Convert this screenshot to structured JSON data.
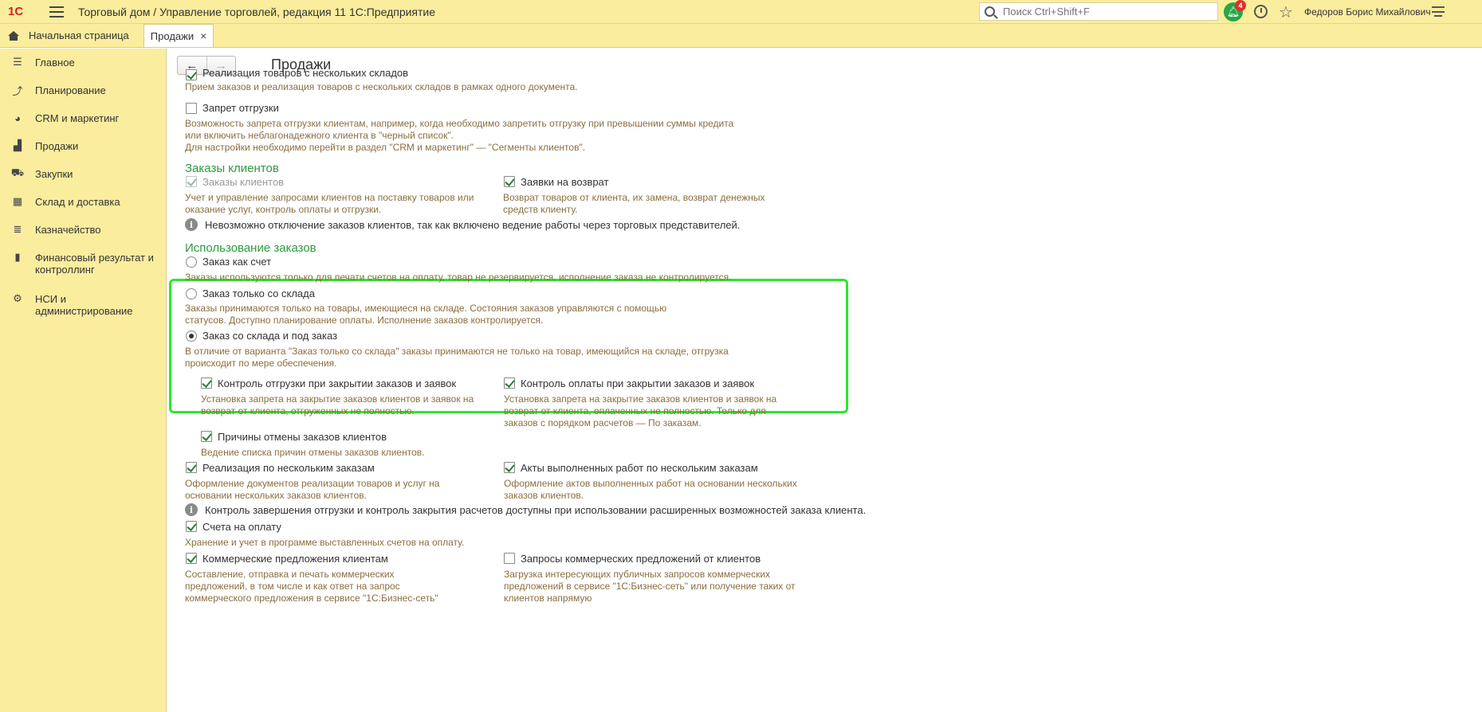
{
  "titlebar": {
    "logo": "1С",
    "title": "Торговый дом / Управление торговлей, редакция 11 1С:Предприятие",
    "search_placeholder": "Поиск Ctrl+Shift+F",
    "notifications_count": "4",
    "username": "Федоров Борис Михайлович"
  },
  "tabs": {
    "home": "Начальная страница",
    "active": "Продажи"
  },
  "sidebar": {
    "items": [
      {
        "label": "Главное",
        "icon": "list-icon"
      },
      {
        "label": "Планирование",
        "icon": "chart-icon"
      },
      {
        "label": "CRM и маркетинг",
        "icon": "pie-icon"
      },
      {
        "label": "Продажи",
        "icon": "bag-icon"
      },
      {
        "label": "Закупки",
        "icon": "cart-icon"
      },
      {
        "label": "Склад и доставка",
        "icon": "grid-icon"
      },
      {
        "label": "Казначейство",
        "icon": "coins-icon"
      },
      {
        "label": "Финансовый результат и контроллинг",
        "icon": "bar-chart-icon"
      },
      {
        "label": "НСИ и администрирование",
        "icon": "gear-icon"
      }
    ]
  },
  "content": {
    "title": "Продажи",
    "multi_warehouse": {
      "label": "Реализация товаров с нескольких складов",
      "desc": "Прием заказов и реализация товаров с нескольких складов в рамках одного документа."
    },
    "shipment_ban": {
      "label": "Запрет отгрузки",
      "desc1": "Возможность запрета отгрузки клиентам, например, когда необходимо запретить отгрузку при превышении суммы кредита",
      "desc2": "или включить неблагонадежного клиента в \"черный список\".",
      "desc3": "Для настройки необходимо перейти в раздел \"CRM и маркетинг\" — \"Сегменты клиентов\"."
    },
    "client_orders_section": "Заказы клиентов",
    "client_orders": {
      "label": "Заказы клиентов",
      "desc1": "Учет и управление запросами клиентов на поставку товаров или",
      "desc2": "оказание услуг, контроль оплаты и отгрузки."
    },
    "return_requests": {
      "label": "Заявки на возврат",
      "desc1": "Возврат товаров от клиента, их замена, возврат денежных",
      "desc2": "средств клиенту."
    },
    "info1": "Невозможно отключение заказов клиентов, так как включено ведение работы через торговых представителей.",
    "orders_usage_section": "Использование заказов",
    "order_as_invoice": {
      "label": "Заказ как счет",
      "desc": "Заказы используются только для печати счетов на оплату, товар не резервируется, исполнение заказа не контролируется."
    },
    "order_from_stock": {
      "label": "Заказ только со склада",
      "desc1": "Заказы принимаются только на товары, имеющиеся на складе. Состояния заказов управляются с помощью",
      "desc2": "статусов. Доступно планирование оплаты. Исполнение заказов контролируется."
    },
    "order_stock_and_custom": {
      "label": "Заказ со склада и под заказ",
      "desc1": "В отличие от варианта \"Заказ только со склада\" заказы принимаются не только на товар, имеющийся на складе, отгрузка",
      "desc2": "происходит по мере обеспечения."
    },
    "shipment_control": {
      "label": "Контроль отгрузки при закрытии заказов и заявок",
      "desc1": "Установка запрета на закрытие заказов клиентов и заявок на",
      "desc2": "возврат от клиента, отгруженных не полностью."
    },
    "payment_control": {
      "label": "Контроль оплаты при закрытии заказов и заявок",
      "desc1": "Установка запрета на закрытие заказов клиентов и заявок на",
      "desc2": "возврат от клиента, оплаченных не полностью. Только для",
      "desc3": "заказов с порядком расчетов — По заказам."
    },
    "cancel_reasons": {
      "label": "Причины отмены заказов клиентов",
      "desc": "Ведение списка причин отмены заказов клиентов."
    },
    "sales_multi_orders": {
      "label": "Реализация по нескольким заказам",
      "desc1": "Оформление документов реализации товаров и услуг на",
      "desc2": "основании нескольких заказов клиентов."
    },
    "acts_multi_orders": {
      "label": "Акты выполненных работ по нескольким заказам",
      "desc1": "Оформление актов выполненных работ на основании нескольких",
      "desc2": "заказов клиентов."
    },
    "info2": "Контроль завершения отгрузки и контроль закрытия расчетов доступны при использовании расширенных возможностей заказа клиента.",
    "invoices": {
      "label": "Счета на оплату",
      "desc": "Хранение и учет в программе выставленных счетов на оплату."
    },
    "commercial_offers": {
      "label": "Коммерческие предложения клиентам",
      "desc1": "Составление, отправка и печать коммерческих",
      "desc2": "предложений, в том числе и как ответ на запрос",
      "desc3": "коммерческого предложения в сервисе \"1С:Бизнес-сеть\""
    },
    "offer_requests": {
      "label": "Запросы коммерческих предложений от клиентов",
      "desc1": "Загрузка интересующих публичных запросов коммерческих",
      "desc2": "предложений в сервисе \"1С:Бизнес-сеть\" или получение таких от",
      "desc3": "клиентов напрямую"
    }
  }
}
